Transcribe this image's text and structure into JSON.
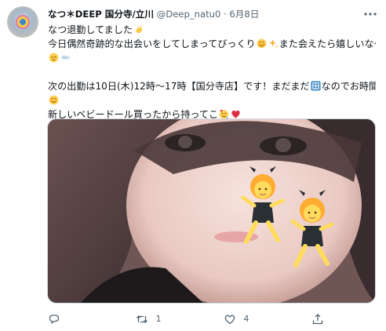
{
  "tweet": {
    "author": {
      "display_name": "なつ＊DEEP 国分寺/立川",
      "handle": "@Deep_natu0",
      "separator": "·",
      "date": "6月8日"
    },
    "lines": [
      "なつ退勤してました",
      "今日偶然奇跡的な出会いをしてしまってびっくり",
      "また会えたら嬉しいな～",
      "次の出勤は10日(木)12時～17時【国分寺店】です！まだまだ",
      "なのでお時間ありましたらよろしくお願いします",
      "新しいベビードール買ったから持ってこ"
    ],
    "reply_count": "",
    "retweet_count": "1",
    "like_count": "4"
  },
  "icons": {
    "more": "more-horizontal-icon",
    "reply": "reply-icon",
    "retweet": "retweet-icon",
    "like": "heart-icon",
    "share": "share-icon"
  },
  "colors": {
    "text": "#0f1419",
    "secondary": "#536471",
    "border": "#cfd9de"
  }
}
